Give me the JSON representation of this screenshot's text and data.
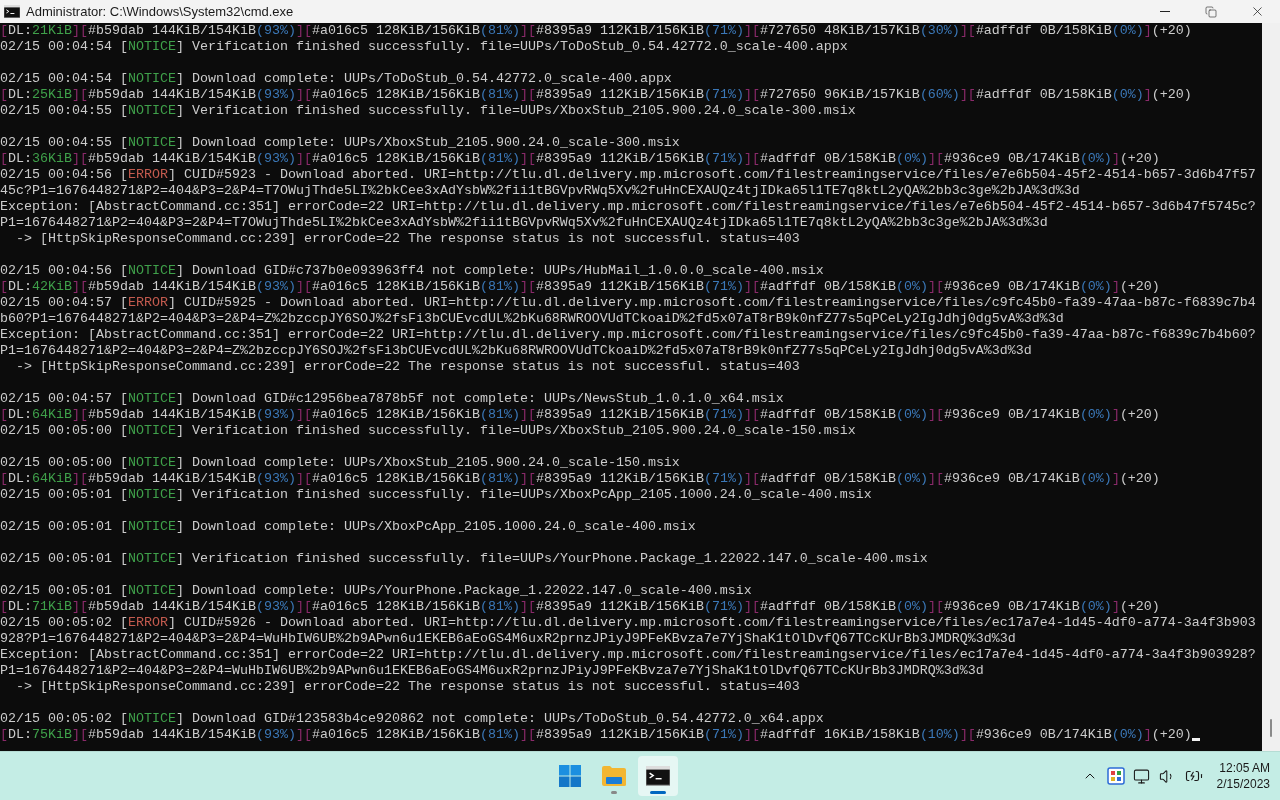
{
  "window": {
    "title": "Administrator: C:\\Windows\\System32\\cmd.exe"
  },
  "terminal": {
    "blocks": [
      {
        "rows": [
          {
            "segments": [
              {
                "text": "[",
                "color": "#8a2a6a"
              },
              {
                "text": "DL:"
              },
              {
                "text": "21KiB",
                "color": "#3fa04a"
              },
              {
                "text": "][",
                "color": "#8a2a6a"
              },
              {
                "text": "#b59dab 144KiB/154KiB"
              },
              {
                "text": "(93%)",
                "color": "#3b78b8"
              },
              {
                "text": "][",
                "color": "#8a2a6a"
              },
              {
                "text": "#a016c5 128KiB/156KiB"
              },
              {
                "text": "(81%)",
                "color": "#3b78b8"
              },
              {
                "text": "][",
                "color": "#8a2a6a"
              },
              {
                "text": "#8395a9 112KiB/156KiB"
              },
              {
                "text": "(71%)",
                "color": "#3b78b8"
              },
              {
                "text": "][",
                "color": "#8a2a6a"
              },
              {
                "text": "#727650 48KiB/157KiB"
              },
              {
                "text": "(30%)",
                "color": "#3b78b8"
              },
              {
                "text": "][",
                "color": "#8a2a6a"
              },
              {
                "text": "#adffdf 0B/158KiB"
              },
              {
                "text": "(0%)",
                "color": "#3b78b8"
              },
              {
                "text": "]",
                "color": "#8a2a6a"
              },
              {
                "text": "(+20)"
              }
            ]
          },
          {
            "segments": [
              {
                "text": "02/15 00:04:54 ["
              },
              {
                "text": "NOTICE",
                "color": "#3fa04a"
              },
              {
                "text": "] Verification finished successfully. file=UUPs/ToDoStub_0.54.42772.0_scale-400.appx"
              }
            ]
          }
        ]
      },
      {
        "rows": [
          {
            "segments": [
              {
                "text": "02/15 00:04:54 ["
              },
              {
                "text": "NOTICE",
                "color": "#3fa04a"
              },
              {
                "text": "] Download complete: UUPs/ToDoStub_0.54.42772.0_scale-400.appx"
              }
            ]
          },
          {
            "segments": [
              {
                "text": "[",
                "color": "#8a2a6a"
              },
              {
                "text": "DL:"
              },
              {
                "text": "25KiB",
                "color": "#3fa04a"
              },
              {
                "text": "][",
                "color": "#8a2a6a"
              },
              {
                "text": "#b59dab 144KiB/154KiB"
              },
              {
                "text": "(93%)",
                "color": "#3b78b8"
              },
              {
                "text": "][",
                "color": "#8a2a6a"
              },
              {
                "text": "#a016c5 128KiB/156KiB"
              },
              {
                "text": "(81%)",
                "color": "#3b78b8"
              },
              {
                "text": "][",
                "color": "#8a2a6a"
              },
              {
                "text": "#8395a9 112KiB/156KiB"
              },
              {
                "text": "(71%)",
                "color": "#3b78b8"
              },
              {
                "text": "][",
                "color": "#8a2a6a"
              },
              {
                "text": "#727650 96KiB/157KiB"
              },
              {
                "text": "(60%)",
                "color": "#3b78b8"
              },
              {
                "text": "][",
                "color": "#8a2a6a"
              },
              {
                "text": "#adffdf 0B/158KiB"
              },
              {
                "text": "(0%)",
                "color": "#3b78b8"
              },
              {
                "text": "]",
                "color": "#8a2a6a"
              },
              {
                "text": "(+20)"
              }
            ]
          },
          {
            "segments": [
              {
                "text": "02/15 00:04:55 ["
              },
              {
                "text": "NOTICE",
                "color": "#3fa04a"
              },
              {
                "text": "] Verification finished successfully. file=UUPs/XboxStub_2105.900.24.0_scale-300.msix"
              }
            ]
          }
        ]
      },
      {
        "rows": [
          {
            "segments": [
              {
                "text": "02/15 00:04:55 ["
              },
              {
                "text": "NOTICE",
                "color": "#3fa04a"
              },
              {
                "text": "] Download complete: UUPs/XboxStub_2105.900.24.0_scale-300.msix"
              }
            ]
          },
          {
            "segments": [
              {
                "text": "[",
                "color": "#8a2a6a"
              },
              {
                "text": "DL:"
              },
              {
                "text": "36KiB",
                "color": "#3fa04a"
              },
              {
                "text": "][",
                "color": "#8a2a6a"
              },
              {
                "text": "#b59dab 144KiB/154KiB"
              },
              {
                "text": "(93%)",
                "color": "#3b78b8"
              },
              {
                "text": "][",
                "color": "#8a2a6a"
              },
              {
                "text": "#a016c5 128KiB/156KiB"
              },
              {
                "text": "(81%)",
                "color": "#3b78b8"
              },
              {
                "text": "][",
                "color": "#8a2a6a"
              },
              {
                "text": "#8395a9 112KiB/156KiB"
              },
              {
                "text": "(71%)",
                "color": "#3b78b8"
              },
              {
                "text": "][",
                "color": "#8a2a6a"
              },
              {
                "text": "#adffdf 0B/158KiB"
              },
              {
                "text": "(0%)",
                "color": "#3b78b8"
              },
              {
                "text": "][",
                "color": "#8a2a6a"
              },
              {
                "text": "#936ce9 0B/174KiB"
              },
              {
                "text": "(0%)",
                "color": "#3b78b8"
              },
              {
                "text": "]",
                "color": "#8a2a6a"
              },
              {
                "text": "(+20)"
              }
            ]
          },
          {
            "segments": [
              {
                "text": "02/15 00:04:56 ["
              },
              {
                "text": "ERROR",
                "color": "#c25a4e"
              },
              {
                "text": "] CUID#5923 - Download aborted. URI=http://tlu.dl.delivery.mp.microsoft.com/filestreamingservice/files/e7e6b504-45f2-4514-b657-3d6b47f57"
              }
            ]
          },
          {
            "segments": [
              {
                "text": "45c?P1=1676448271&P2=404&P3=2&P4=T7OWujThde5LI%2bkCee3xAdYsbW%2fii1tBGVpvRWq5Xv%2fuHnCEXAUQz4tjIDka65l1TE7q8ktL2yQA%2bb3c3ge%2bJA%3d%3d"
              }
            ]
          },
          {
            "segments": [
              {
                "text": "Exception: [AbstractCommand.cc:351] errorCode=22 URI=http://tlu.dl.delivery.mp.microsoft.com/filestreamingservice/files/e7e6b504-45f2-4514-b657-3d6b47f5745c?"
              }
            ]
          },
          {
            "segments": [
              {
                "text": "P1=1676448271&P2=404&P3=2&P4=T7OWujThde5LI%2bkCee3xAdYsbW%2fii1tBGVpvRWq5Xv%2fuHnCEXAUQz4tjIDka65l1TE7q8ktL2yQA%2bb3c3ge%2bJA%3d%3d"
              }
            ]
          },
          {
            "segments": [
              {
                "text": "  -> [HttpSkipResponseCommand.cc:239] errorCode=22 The response status is not successful. status=403"
              }
            ]
          }
        ]
      },
      {
        "rows": [
          {
            "segments": [
              {
                "text": "02/15 00:04:56 ["
              },
              {
                "text": "NOTICE",
                "color": "#3fa04a"
              },
              {
                "text": "] Download GID#c737b0e093963ff4 not complete: UUPs/HubMail_1.0.0.0_scale-400.msix"
              }
            ]
          },
          {
            "segments": [
              {
                "text": "[",
                "color": "#8a2a6a"
              },
              {
                "text": "DL:"
              },
              {
                "text": "42KiB",
                "color": "#3fa04a"
              },
              {
                "text": "][",
                "color": "#8a2a6a"
              },
              {
                "text": "#b59dab 144KiB/154KiB"
              },
              {
                "text": "(93%)",
                "color": "#3b78b8"
              },
              {
                "text": "][",
                "color": "#8a2a6a"
              },
              {
                "text": "#a016c5 128KiB/156KiB"
              },
              {
                "text": "(81%)",
                "color": "#3b78b8"
              },
              {
                "text": "][",
                "color": "#8a2a6a"
              },
              {
                "text": "#8395a9 112KiB/156KiB"
              },
              {
                "text": "(71%)",
                "color": "#3b78b8"
              },
              {
                "text": "][",
                "color": "#8a2a6a"
              },
              {
                "text": "#adffdf 0B/158KiB"
              },
              {
                "text": "(0%)",
                "color": "#3b78b8"
              },
              {
                "text": "][",
                "color": "#8a2a6a"
              },
              {
                "text": "#936ce9 0B/174KiB"
              },
              {
                "text": "(0%)",
                "color": "#3b78b8"
              },
              {
                "text": "]",
                "color": "#8a2a6a"
              },
              {
                "text": "(+20)"
              }
            ]
          },
          {
            "segments": [
              {
                "text": "02/15 00:04:57 ["
              },
              {
                "text": "ERROR",
                "color": "#c25a4e"
              },
              {
                "text": "] CUID#5925 - Download aborted. URI=http://tlu.dl.delivery.mp.microsoft.com/filestreamingservice/files/c9fc45b0-fa39-47aa-b87c-f6839c7b4"
              }
            ]
          },
          {
            "segments": [
              {
                "text": "b60?P1=1676448271&P2=404&P3=2&P4=Z%2bzccpJY6SOJ%2fsFi3bCUEvcdUL%2bKu68RWROOVUdTCkoaiD%2fd5x07aT8rB9k0nfZ77s5qPCeLy2IgJdhj0dg5vA%3d%3d"
              }
            ]
          },
          {
            "segments": [
              {
                "text": "Exception: [AbstractCommand.cc:351] errorCode=22 URI=http://tlu.dl.delivery.mp.microsoft.com/filestreamingservice/files/c9fc45b0-fa39-47aa-b87c-f6839c7b4b60?"
              }
            ]
          },
          {
            "segments": [
              {
                "text": "P1=1676448271&P2=404&P3=2&P4=Z%2bzccpJY6SOJ%2fsFi3bCUEvcdUL%2bKu68RWROOVUdTCkoaiD%2fd5x07aT8rB9k0nfZ77s5qPCeLy2IgJdhj0dg5vA%3d%3d"
              }
            ]
          },
          {
            "segments": [
              {
                "text": "  -> [HttpSkipResponseCommand.cc:239] errorCode=22 The response status is not successful. status=403"
              }
            ]
          }
        ]
      },
      {
        "rows": [
          {
            "segments": [
              {
                "text": "02/15 00:04:57 ["
              },
              {
                "text": "NOTICE",
                "color": "#3fa04a"
              },
              {
                "text": "] Download GID#c12956bea7878b5f not complete: UUPs/NewsStub_1.0.1.0_x64.msix"
              }
            ]
          },
          {
            "segments": [
              {
                "text": "[",
                "color": "#8a2a6a"
              },
              {
                "text": "DL:"
              },
              {
                "text": "64KiB",
                "color": "#3fa04a"
              },
              {
                "text": "][",
                "color": "#8a2a6a"
              },
              {
                "text": "#b59dab 144KiB/154KiB"
              },
              {
                "text": "(93%)",
                "color": "#3b78b8"
              },
              {
                "text": "][",
                "color": "#8a2a6a"
              },
              {
                "text": "#a016c5 128KiB/156KiB"
              },
              {
                "text": "(81%)",
                "color": "#3b78b8"
              },
              {
                "text": "][",
                "color": "#8a2a6a"
              },
              {
                "text": "#8395a9 112KiB/156KiB"
              },
              {
                "text": "(71%)",
                "color": "#3b78b8"
              },
              {
                "text": "][",
                "color": "#8a2a6a"
              },
              {
                "text": "#adffdf 0B/158KiB"
              },
              {
                "text": "(0%)",
                "color": "#3b78b8"
              },
              {
                "text": "][",
                "color": "#8a2a6a"
              },
              {
                "text": "#936ce9 0B/174KiB"
              },
              {
                "text": "(0%)",
                "color": "#3b78b8"
              },
              {
                "text": "]",
                "color": "#8a2a6a"
              },
              {
                "text": "(+20)"
              }
            ]
          },
          {
            "segments": [
              {
                "text": "02/15 00:05:00 ["
              },
              {
                "text": "NOTICE",
                "color": "#3fa04a"
              },
              {
                "text": "] Verification finished successfully. file=UUPs/XboxStub_2105.900.24.0_scale-150.msix"
              }
            ]
          }
        ]
      },
      {
        "rows": [
          {
            "segments": [
              {
                "text": "02/15 00:05:00 ["
              },
              {
                "text": "NOTICE",
                "color": "#3fa04a"
              },
              {
                "text": "] Download complete: UUPs/XboxStub_2105.900.24.0_scale-150.msix"
              }
            ]
          },
          {
            "segments": [
              {
                "text": "[",
                "color": "#8a2a6a"
              },
              {
                "text": "DL:"
              },
              {
                "text": "64KiB",
                "color": "#3fa04a"
              },
              {
                "text": "][",
                "color": "#8a2a6a"
              },
              {
                "text": "#b59dab 144KiB/154KiB"
              },
              {
                "text": "(93%)",
                "color": "#3b78b8"
              },
              {
                "text": "][",
                "color": "#8a2a6a"
              },
              {
                "text": "#a016c5 128KiB/156KiB"
              },
              {
                "text": "(81%)",
                "color": "#3b78b8"
              },
              {
                "text": "][",
                "color": "#8a2a6a"
              },
              {
                "text": "#8395a9 112KiB/156KiB"
              },
              {
                "text": "(71%)",
                "color": "#3b78b8"
              },
              {
                "text": "][",
                "color": "#8a2a6a"
              },
              {
                "text": "#adffdf 0B/158KiB"
              },
              {
                "text": "(0%)",
                "color": "#3b78b8"
              },
              {
                "text": "][",
                "color": "#8a2a6a"
              },
              {
                "text": "#936ce9 0B/174KiB"
              },
              {
                "text": "(0%)",
                "color": "#3b78b8"
              },
              {
                "text": "]",
                "color": "#8a2a6a"
              },
              {
                "text": "(+20)"
              }
            ]
          },
          {
            "segments": [
              {
                "text": "02/15 00:05:01 ["
              },
              {
                "text": "NOTICE",
                "color": "#3fa04a"
              },
              {
                "text": "] Verification finished successfully. file=UUPs/XboxPcApp_2105.1000.24.0_scale-400.msix"
              }
            ]
          }
        ]
      },
      {
        "rows": [
          {
            "segments": [
              {
                "text": "02/15 00:05:01 ["
              },
              {
                "text": "NOTICE",
                "color": "#3fa04a"
              },
              {
                "text": "] Download complete: UUPs/XboxPcApp_2105.1000.24.0_scale-400.msix"
              }
            ]
          }
        ]
      },
      {
        "rows": [
          {
            "segments": [
              {
                "text": "02/15 00:05:01 ["
              },
              {
                "text": "NOTICE",
                "color": "#3fa04a"
              },
              {
                "text": "] Verification finished successfully. file=UUPs/YourPhone.Package_1.22022.147.0_scale-400.msix"
              }
            ]
          }
        ]
      },
      {
        "rows": [
          {
            "segments": [
              {
                "text": "02/15 00:05:01 ["
              },
              {
                "text": "NOTICE",
                "color": "#3fa04a"
              },
              {
                "text": "] Download complete: UUPs/YourPhone.Package_1.22022.147.0_scale-400.msix"
              }
            ]
          },
          {
            "segments": [
              {
                "text": "[",
                "color": "#8a2a6a"
              },
              {
                "text": "DL:"
              },
              {
                "text": "71KiB",
                "color": "#3fa04a"
              },
              {
                "text": "][",
                "color": "#8a2a6a"
              },
              {
                "text": "#b59dab 144KiB/154KiB"
              },
              {
                "text": "(93%)",
                "color": "#3b78b8"
              },
              {
                "text": "][",
                "color": "#8a2a6a"
              },
              {
                "text": "#a016c5 128KiB/156KiB"
              },
              {
                "text": "(81%)",
                "color": "#3b78b8"
              },
              {
                "text": "][",
                "color": "#8a2a6a"
              },
              {
                "text": "#8395a9 112KiB/156KiB"
              },
              {
                "text": "(71%)",
                "color": "#3b78b8"
              },
              {
                "text": "][",
                "color": "#8a2a6a"
              },
              {
                "text": "#adffdf 0B/158KiB"
              },
              {
                "text": "(0%)",
                "color": "#3b78b8"
              },
              {
                "text": "][",
                "color": "#8a2a6a"
              },
              {
                "text": "#936ce9 0B/174KiB"
              },
              {
                "text": "(0%)",
                "color": "#3b78b8"
              },
              {
                "text": "]",
                "color": "#8a2a6a"
              },
              {
                "text": "(+20)"
              }
            ]
          },
          {
            "segments": [
              {
                "text": "02/15 00:05:02 ["
              },
              {
                "text": "ERROR",
                "color": "#c25a4e"
              },
              {
                "text": "] CUID#5926 - Download aborted. URI=http://tlu.dl.delivery.mp.microsoft.com/filestreamingservice/files/ec17a7e4-1d45-4df0-a774-3a4f3b903"
              }
            ]
          },
          {
            "segments": [
              {
                "text": "928?P1=1676448271&P2=404&P3=2&P4=WuHbIW6UB%2b9APwn6u1EKEB6aEoGS4M6uxR2prnzJPiyJ9PFeKBvza7e7YjShaK1tOlDvfQ67TCcKUrBb3JMDRQ%3d%3d"
              }
            ]
          },
          {
            "segments": [
              {
                "text": "Exception: [AbstractCommand.cc:351] errorCode=22 URI=http://tlu.dl.delivery.mp.microsoft.com/filestreamingservice/files/ec17a7e4-1d45-4df0-a774-3a4f3b903928?"
              }
            ]
          },
          {
            "segments": [
              {
                "text": "P1=1676448271&P2=404&P3=2&P4=WuHbIW6UB%2b9APwn6u1EKEB6aEoGS4M6uxR2prnzJPiyJ9PFeKBvza7e7YjShaK1tOlDvfQ67TCcKUrBb3JMDRQ%3d%3d"
              }
            ]
          },
          {
            "segments": [
              {
                "text": "  -> [HttpSkipResponseCommand.cc:239] errorCode=22 The response status is not successful. status=403"
              }
            ]
          }
        ]
      },
      {
        "rows": [
          {
            "segments": [
              {
                "text": "02/15 00:05:02 ["
              },
              {
                "text": "NOTICE",
                "color": "#3fa04a"
              },
              {
                "text": "] Download GID#123583b4ce920862 not complete: UUPs/ToDoStub_0.54.42772.0_x64.appx"
              }
            ]
          },
          {
            "segments": [
              {
                "text": "[",
                "color": "#8a2a6a"
              },
              {
                "text": "DL:"
              },
              {
                "text": "75KiB",
                "color": "#3fa04a"
              },
              {
                "text": "][",
                "color": "#8a2a6a"
              },
              {
                "text": "#b59dab 144KiB/154KiB"
              },
              {
                "text": "(93%)",
                "color": "#3b78b8"
              },
              {
                "text": "][",
                "color": "#8a2a6a"
              },
              {
                "text": "#a016c5 128KiB/156KiB"
              },
              {
                "text": "(81%)",
                "color": "#3b78b8"
              },
              {
                "text": "][",
                "color": "#8a2a6a"
              },
              {
                "text": "#8395a9 112KiB/156KiB"
              },
              {
                "text": "(71%)",
                "color": "#3b78b8"
              },
              {
                "text": "][",
                "color": "#8a2a6a"
              },
              {
                "text": "#adffdf 16KiB/158KiB"
              },
              {
                "text": "(10%)",
                "color": "#3b78b8"
              },
              {
                "text": "][",
                "color": "#8a2a6a"
              },
              {
                "text": "#936ce9 0B/174KiB"
              },
              {
                "text": "(0%)",
                "color": "#3b78b8"
              },
              {
                "text": "]",
                "color": "#8a2a6a"
              },
              {
                "text": "(+20)"
              }
            ]
          }
        ]
      }
    ]
  },
  "taskbar": {
    "apps": [
      {
        "kind": "start",
        "selected": false,
        "running": false
      },
      {
        "kind": "folder",
        "selected": false,
        "running": true
      },
      {
        "kind": "terminal",
        "selected": true,
        "running": true
      }
    ],
    "clock": {
      "time": "12:05 AM",
      "date": "2/15/2023"
    }
  }
}
